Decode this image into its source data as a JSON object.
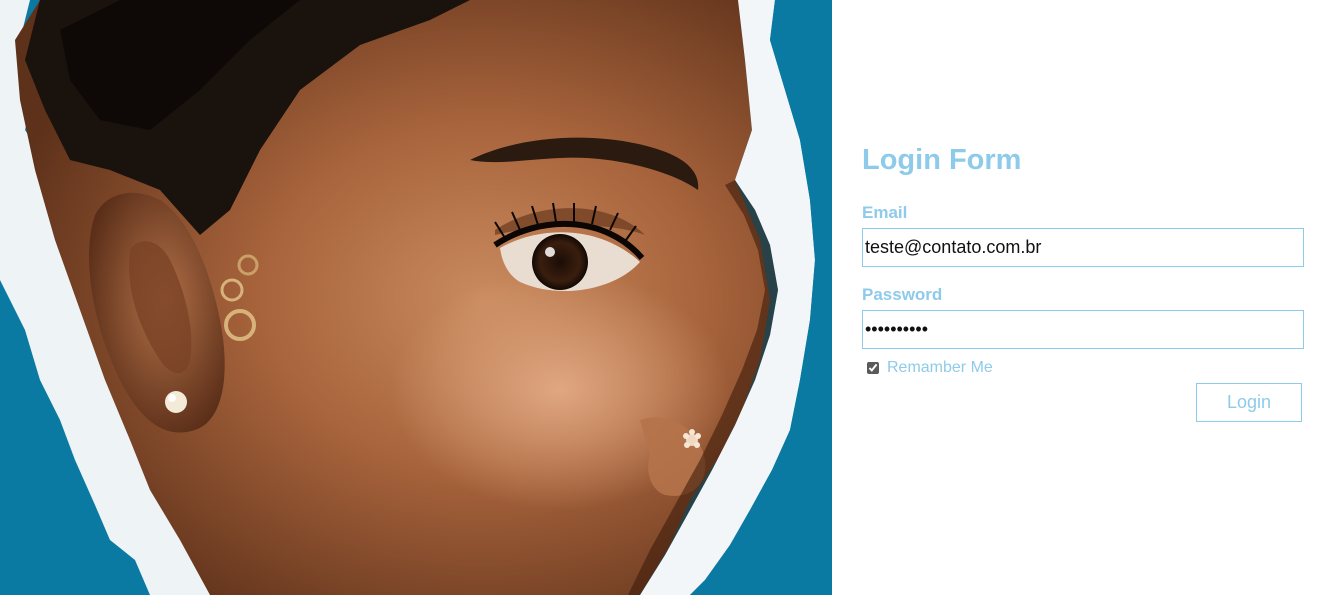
{
  "form": {
    "title": "Login Form",
    "email_label": "Email",
    "email_value": "teste@contato.com.br",
    "password_label": "Password",
    "password_value": "1234567890",
    "remember_label": "Remamber Me",
    "remember_checked": true,
    "login_label": "Login"
  },
  "colors": {
    "accent": "#8ecbeb",
    "hero_background": "#0a7aa3"
  },
  "hero": {
    "icon": "portrait-photo"
  }
}
